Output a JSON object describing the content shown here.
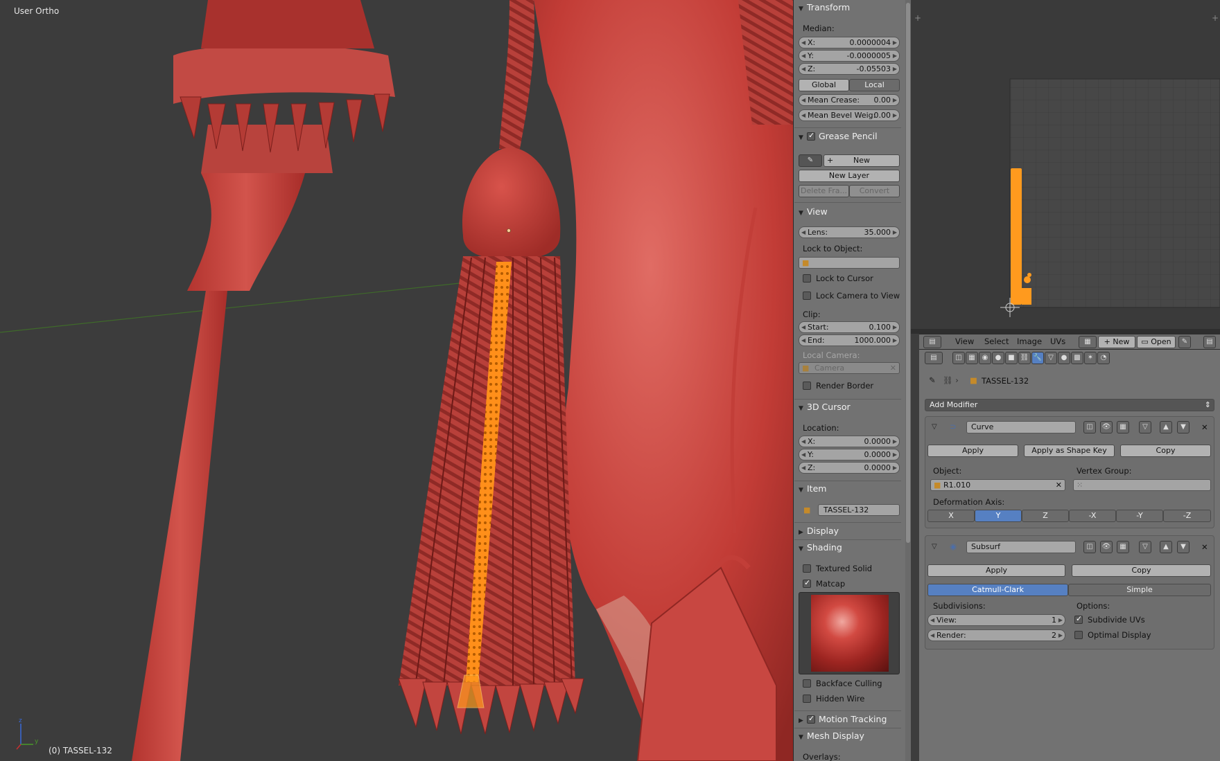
{
  "viewport": {
    "view_label": "User Ortho",
    "object_label": "(0) TASSEL-132",
    "axis_x": "x",
    "axis_y": "y",
    "axis_z": "z"
  },
  "npanel": {
    "transform": {
      "title": "Transform",
      "median_label": "Median:",
      "x_label": "X:",
      "x_value": "0.0000004",
      "y_label": "Y:",
      "y_value": "-0.0000005",
      "z_label": "Z:",
      "z_value": "-0.05503",
      "global": "Global",
      "local": "Local",
      "mean_crease_label": "Mean Crease:",
      "mean_crease_value": "0.00",
      "mean_bevel_label": "Mean Bevel Weig:",
      "mean_bevel_value": "0.00"
    },
    "grease_pencil": {
      "title": "Grease Pencil",
      "new": "New",
      "new_layer": "New Layer",
      "delete_frame": "Delete Fra...",
      "convert": "Convert"
    },
    "view": {
      "title": "View",
      "lens_label": "Lens:",
      "lens_value": "35.000",
      "lock_object_label": "Lock to Object:",
      "lock_cursor": "Lock to Cursor",
      "lock_camera": "Lock Camera to View",
      "clip_label": "Clip:",
      "start_label": "Start:",
      "start_value": "0.100",
      "end_label": "End:",
      "end_value": "1000.000",
      "local_camera_label": "Local Camera:",
      "camera_value": "Camera",
      "render_border": "Render Border"
    },
    "cursor": {
      "title": "3D Cursor",
      "location_label": "Location:",
      "x_label": "X:",
      "x_value": "0.0000",
      "y_label": "Y:",
      "y_value": "0.0000",
      "z_label": "Z:",
      "z_value": "0.0000"
    },
    "item": {
      "title": "Item",
      "name": "TASSEL-132"
    },
    "display": {
      "title": "Display"
    },
    "shading": {
      "title": "Shading",
      "textured_solid": "Textured Solid",
      "matcap": "Matcap",
      "backface_culling": "Backface Culling",
      "hidden_wire": "Hidden Wire"
    },
    "motion_tracking": {
      "title": "Motion Tracking"
    },
    "mesh_display": {
      "title": "Mesh Display",
      "overlays_label": "Overlays:"
    }
  },
  "uv_header": {
    "view": "View",
    "select": "Select",
    "image": "Image",
    "uvs": "UVs",
    "new": "New",
    "open": "Open"
  },
  "properties": {
    "object_name": "TASSEL-132",
    "add_modifier": "Add Modifier",
    "curve": {
      "name": "Curve",
      "apply": "Apply",
      "apply_shape_key": "Apply as Shape Key",
      "copy": "Copy",
      "object_label": "Object:",
      "object_value": "R1.010",
      "vertex_group_label": "Vertex Group:",
      "deformation_axis_label": "Deformation Axis:",
      "axes": [
        "X",
        "Y",
        "Z",
        "-X",
        "-Y",
        "-Z"
      ],
      "selected_axis": "Y"
    },
    "subsurf": {
      "name": "Subsurf",
      "apply": "Apply",
      "copy": "Copy",
      "catmull_clark": "Catmull-Clark",
      "simple": "Simple",
      "subdivisions_label": "Subdivisions:",
      "view_label": "View:",
      "view_value": "1",
      "render_label": "Render:",
      "render_value": "2",
      "options_label": "Options:",
      "subdivide_uvs": "Subdivide UVs",
      "optimal_display": "Optimal Display"
    }
  },
  "colors": {
    "mesh_red": "#c9423c",
    "selection_orange": "#ff9a1e",
    "selected_button": "#5680c2"
  }
}
